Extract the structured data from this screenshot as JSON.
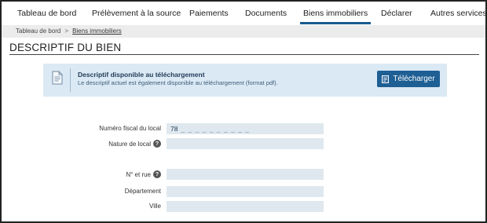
{
  "nav": {
    "items": [
      {
        "label": "Tableau de bord"
      },
      {
        "label": "Prélèvement à la source"
      },
      {
        "label": "Paiements"
      },
      {
        "label": "Documents"
      },
      {
        "label": "Biens immobiliers",
        "active": true
      },
      {
        "label": "Déclarer"
      },
      {
        "label": "Autres services"
      }
    ]
  },
  "breadcrumb": {
    "home": "Tableau de bord",
    "separator": ">",
    "current": "Biens immobiliers"
  },
  "page": {
    "title": "DESCRIPTIF DU BIEN"
  },
  "banner": {
    "icon": "document-icon",
    "title": "Descriptif disponible au téléchargement",
    "subtitle": "Le descriptif actuel est également disponible au téléchargement (format pdf).",
    "button_label": "Télécharger",
    "button_icon": "download-document-icon"
  },
  "form": {
    "fiscal_number": {
      "label": "Numéro fiscal du local",
      "value": "78",
      "mask": "_ _ _ _ _ _ _ _ _ _"
    },
    "nature": {
      "label": "Nature de local",
      "help_icon": "help-icon",
      "value": ""
    },
    "street": {
      "label": "N° et rue",
      "help_icon": "help-icon",
      "value": ""
    },
    "department": {
      "label": "Département",
      "value": ""
    },
    "city": {
      "label": "Ville",
      "value": ""
    }
  },
  "colors": {
    "accent": "#1e5f94",
    "banner_bg": "#dbe9f4",
    "field_bg": "#dfe8ee"
  }
}
